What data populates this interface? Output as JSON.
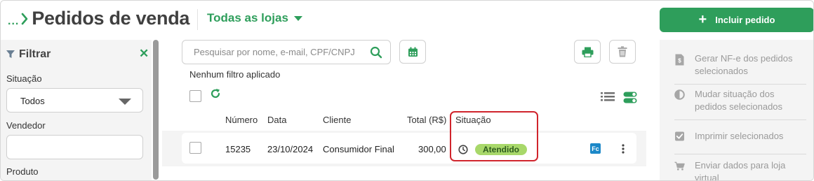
{
  "header": {
    "breadcrumb_dots": "...",
    "title": "Pedidos de venda",
    "store_selector": "Todas as lojas",
    "include_button": "Incluir pedido",
    "include_plus": "+"
  },
  "filter": {
    "title": "Filtrar",
    "close": "✕",
    "situacao_label": "Situação",
    "situacao_value": "Todos",
    "vendedor_label": "Vendedor",
    "vendedor_value": "",
    "produto_label": "Produto"
  },
  "toolbar": {
    "search_placeholder": "Pesquisar por nome, e-mail, CPF/CNPJ",
    "no_filter_text": "Nenhum filtro aplicado"
  },
  "table": {
    "columns": [
      "Número",
      "Data",
      "Cliente",
      "Total (R$)",
      "Situação"
    ],
    "rows": [
      {
        "numero": "15235",
        "data": "23/10/2024",
        "cliente": "Consumidor Final",
        "total": "300,00",
        "situacao": "Atendido",
        "nfe_badge": "Fc"
      }
    ]
  },
  "actions": {
    "items": [
      {
        "icon": "invoice-icon",
        "label": "Gerar NF-e dos pedidos selecionados"
      },
      {
        "icon": "half-circle-icon",
        "label": "Mudar situação dos pedidos selecionados"
      },
      {
        "icon": "checkbox-icon",
        "label": "Imprimir selecionados"
      },
      {
        "icon": "cart-icon",
        "label": "Enviar dados para loja virtual"
      }
    ]
  },
  "colors": {
    "brand_green": "#2e9e5b",
    "status_green": "#a8d86a",
    "highlight_red": "#d0242c",
    "nfe_blue": "#1c88c8"
  }
}
